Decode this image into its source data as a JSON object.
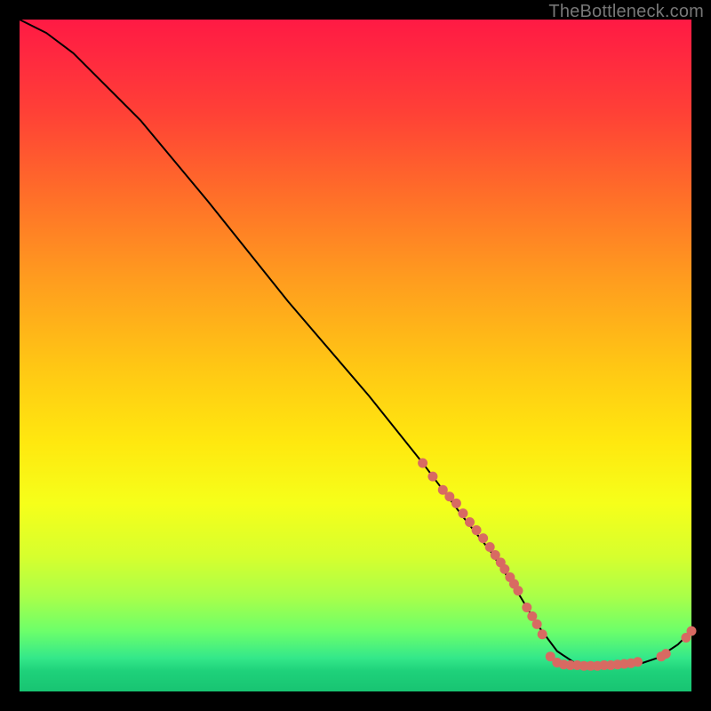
{
  "watermark": "TheBottleneck.com",
  "chart_data": {
    "type": "line",
    "title": "",
    "xlabel": "",
    "ylabel": "",
    "xlim": [
      0,
      100
    ],
    "ylim": [
      0,
      100
    ],
    "grid": false,
    "legend": false,
    "series": [
      {
        "name": "curve",
        "style": "line",
        "color": "#000000",
        "x": [
          0,
          4,
          8,
          12,
          18,
          28,
          40,
          52,
          60,
          66,
          70,
          74,
          77,
          80,
          83,
          86,
          89,
          92,
          95,
          98,
          100
        ],
        "y": [
          100,
          98,
          95,
          91,
          85,
          73,
          58,
          44,
          34,
          26,
          21,
          15,
          10,
          6,
          4,
          4,
          4,
          4,
          5,
          7,
          9
        ]
      },
      {
        "name": "points-descent",
        "style": "scatter",
        "color": "#d86a62",
        "radius": 5.5,
        "x": [
          60,
          61.5,
          63,
          64,
          65,
          66,
          67,
          68,
          69,
          70,
          70.8,
          71.6,
          72.2,
          73,
          73.6,
          74.2,
          75.5,
          76.3,
          77,
          77.8
        ],
        "y": [
          34,
          32,
          30,
          29,
          28,
          26.5,
          25.2,
          24,
          22.8,
          21.5,
          20.3,
          19.2,
          18.2,
          17,
          16,
          15,
          12.5,
          11.2,
          10,
          8.5
        ]
      },
      {
        "name": "points-flat",
        "style": "scatter",
        "color": "#d86a62",
        "radius": 5.5,
        "x": [
          79,
          80,
          81,
          82,
          83,
          84,
          85,
          86,
          87,
          88,
          89,
          90,
          91,
          92
        ],
        "y": [
          5.2,
          4.3,
          4.0,
          3.9,
          3.9,
          3.8,
          3.8,
          3.8,
          3.9,
          3.9,
          4.0,
          4.1,
          4.2,
          4.4
        ]
      },
      {
        "name": "points-rise",
        "style": "scatter",
        "color": "#d86a62",
        "radius": 5.5,
        "x": [
          95.5,
          96.2,
          99.2,
          100
        ],
        "y": [
          5.2,
          5.6,
          8.0,
          9.0
        ]
      }
    ]
  }
}
